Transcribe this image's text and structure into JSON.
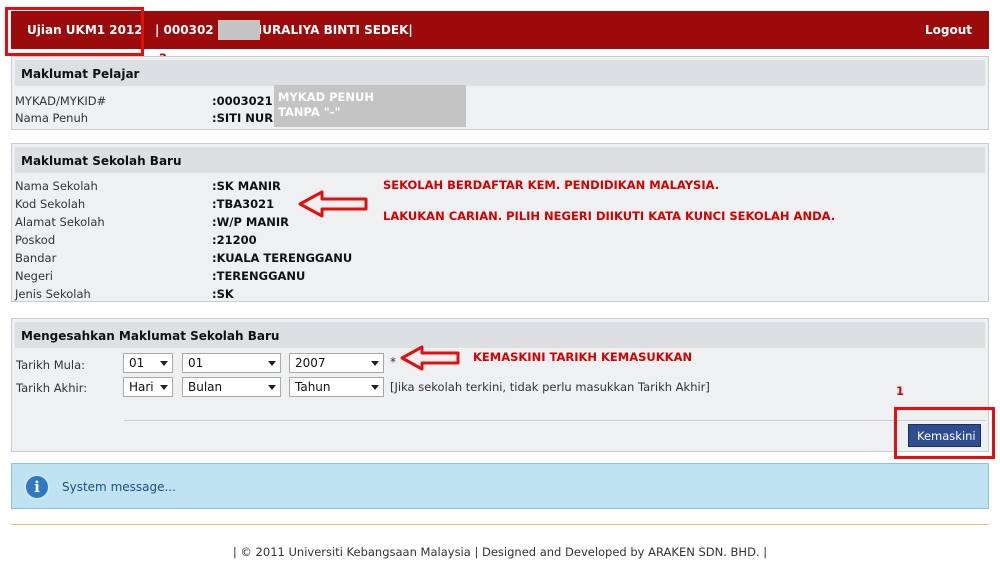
{
  "header": {
    "app_title": "Ujian UKM1 2012",
    "user_info": "| 000302 |SITI NURALIYA BINTI SEDEK|",
    "logout": "Logout"
  },
  "pelajar": {
    "title": "Maklumat Pelajar",
    "mykad_label": "MYKAD/MYKID#",
    "mykad_value": ":0003021",
    "nama_label": "Nama Penuh",
    "nama_value": ":SITI NUR",
    "note_line1": "MYKAD PENUH",
    "note_line2": "TANPA \"-\""
  },
  "sekolah": {
    "title": "Maklumat Sekolah Baru",
    "rows": [
      {
        "label": "Nama Sekolah",
        "value": ":SK MANIR"
      },
      {
        "label": "Kod Sekolah",
        "value": ":TBA3021"
      },
      {
        "label": "Alamat Sekolah",
        "value": ":W/P MANIR"
      },
      {
        "label": "Poskod",
        "value": ":21200"
      },
      {
        "label": "Bandar",
        "value": ":KUALA TERENGGANU"
      },
      {
        "label": "Negeri",
        "value": ":TERENGGANU"
      },
      {
        "label": "Jenis Sekolah",
        "value": ":SK"
      }
    ]
  },
  "sahkan": {
    "title": "Mengesahkan Maklumat Sekolah Baru",
    "mula_label": "Tarikh Mula:",
    "mula_day": "01",
    "mula_month": "01",
    "mula_year": "2007",
    "required_mark": "*",
    "akhir_label": "Tarikh Akhir:",
    "akhir_day": "Hari",
    "akhir_month": "Bulan",
    "akhir_year": "Tahun",
    "akhir_note": "[Jika sekolah terkini, tidak perlu masukkan Tarikh Akhir]",
    "button": "Kemaskini"
  },
  "annotations": {
    "num2": "2",
    "num1": "1",
    "sekolah_note1": "SEKOLAH BERDAFTAR KEM. PENDIDIKAN MALAYSIA.",
    "sekolah_note2": "LAKUKAN CARIAN. PILIH NEGERI DIIKUTI KATA KUNCI SEKOLAH ANDA.",
    "tarikh_note": "KEMASKINI TARIKH KEMASUKKAN"
  },
  "system": {
    "message": "System message..."
  },
  "footer": {
    "text": "| © 2011 Universiti Kebangsaan Malaysia | Designed and Developed by ARAKEN SDN. BHD. |"
  },
  "colors": {
    "header_bg": "#9b0b0b",
    "annotation_red": "#d40000",
    "button_bg": "#2f4d8f",
    "message_bg": "#bfe3f2"
  }
}
